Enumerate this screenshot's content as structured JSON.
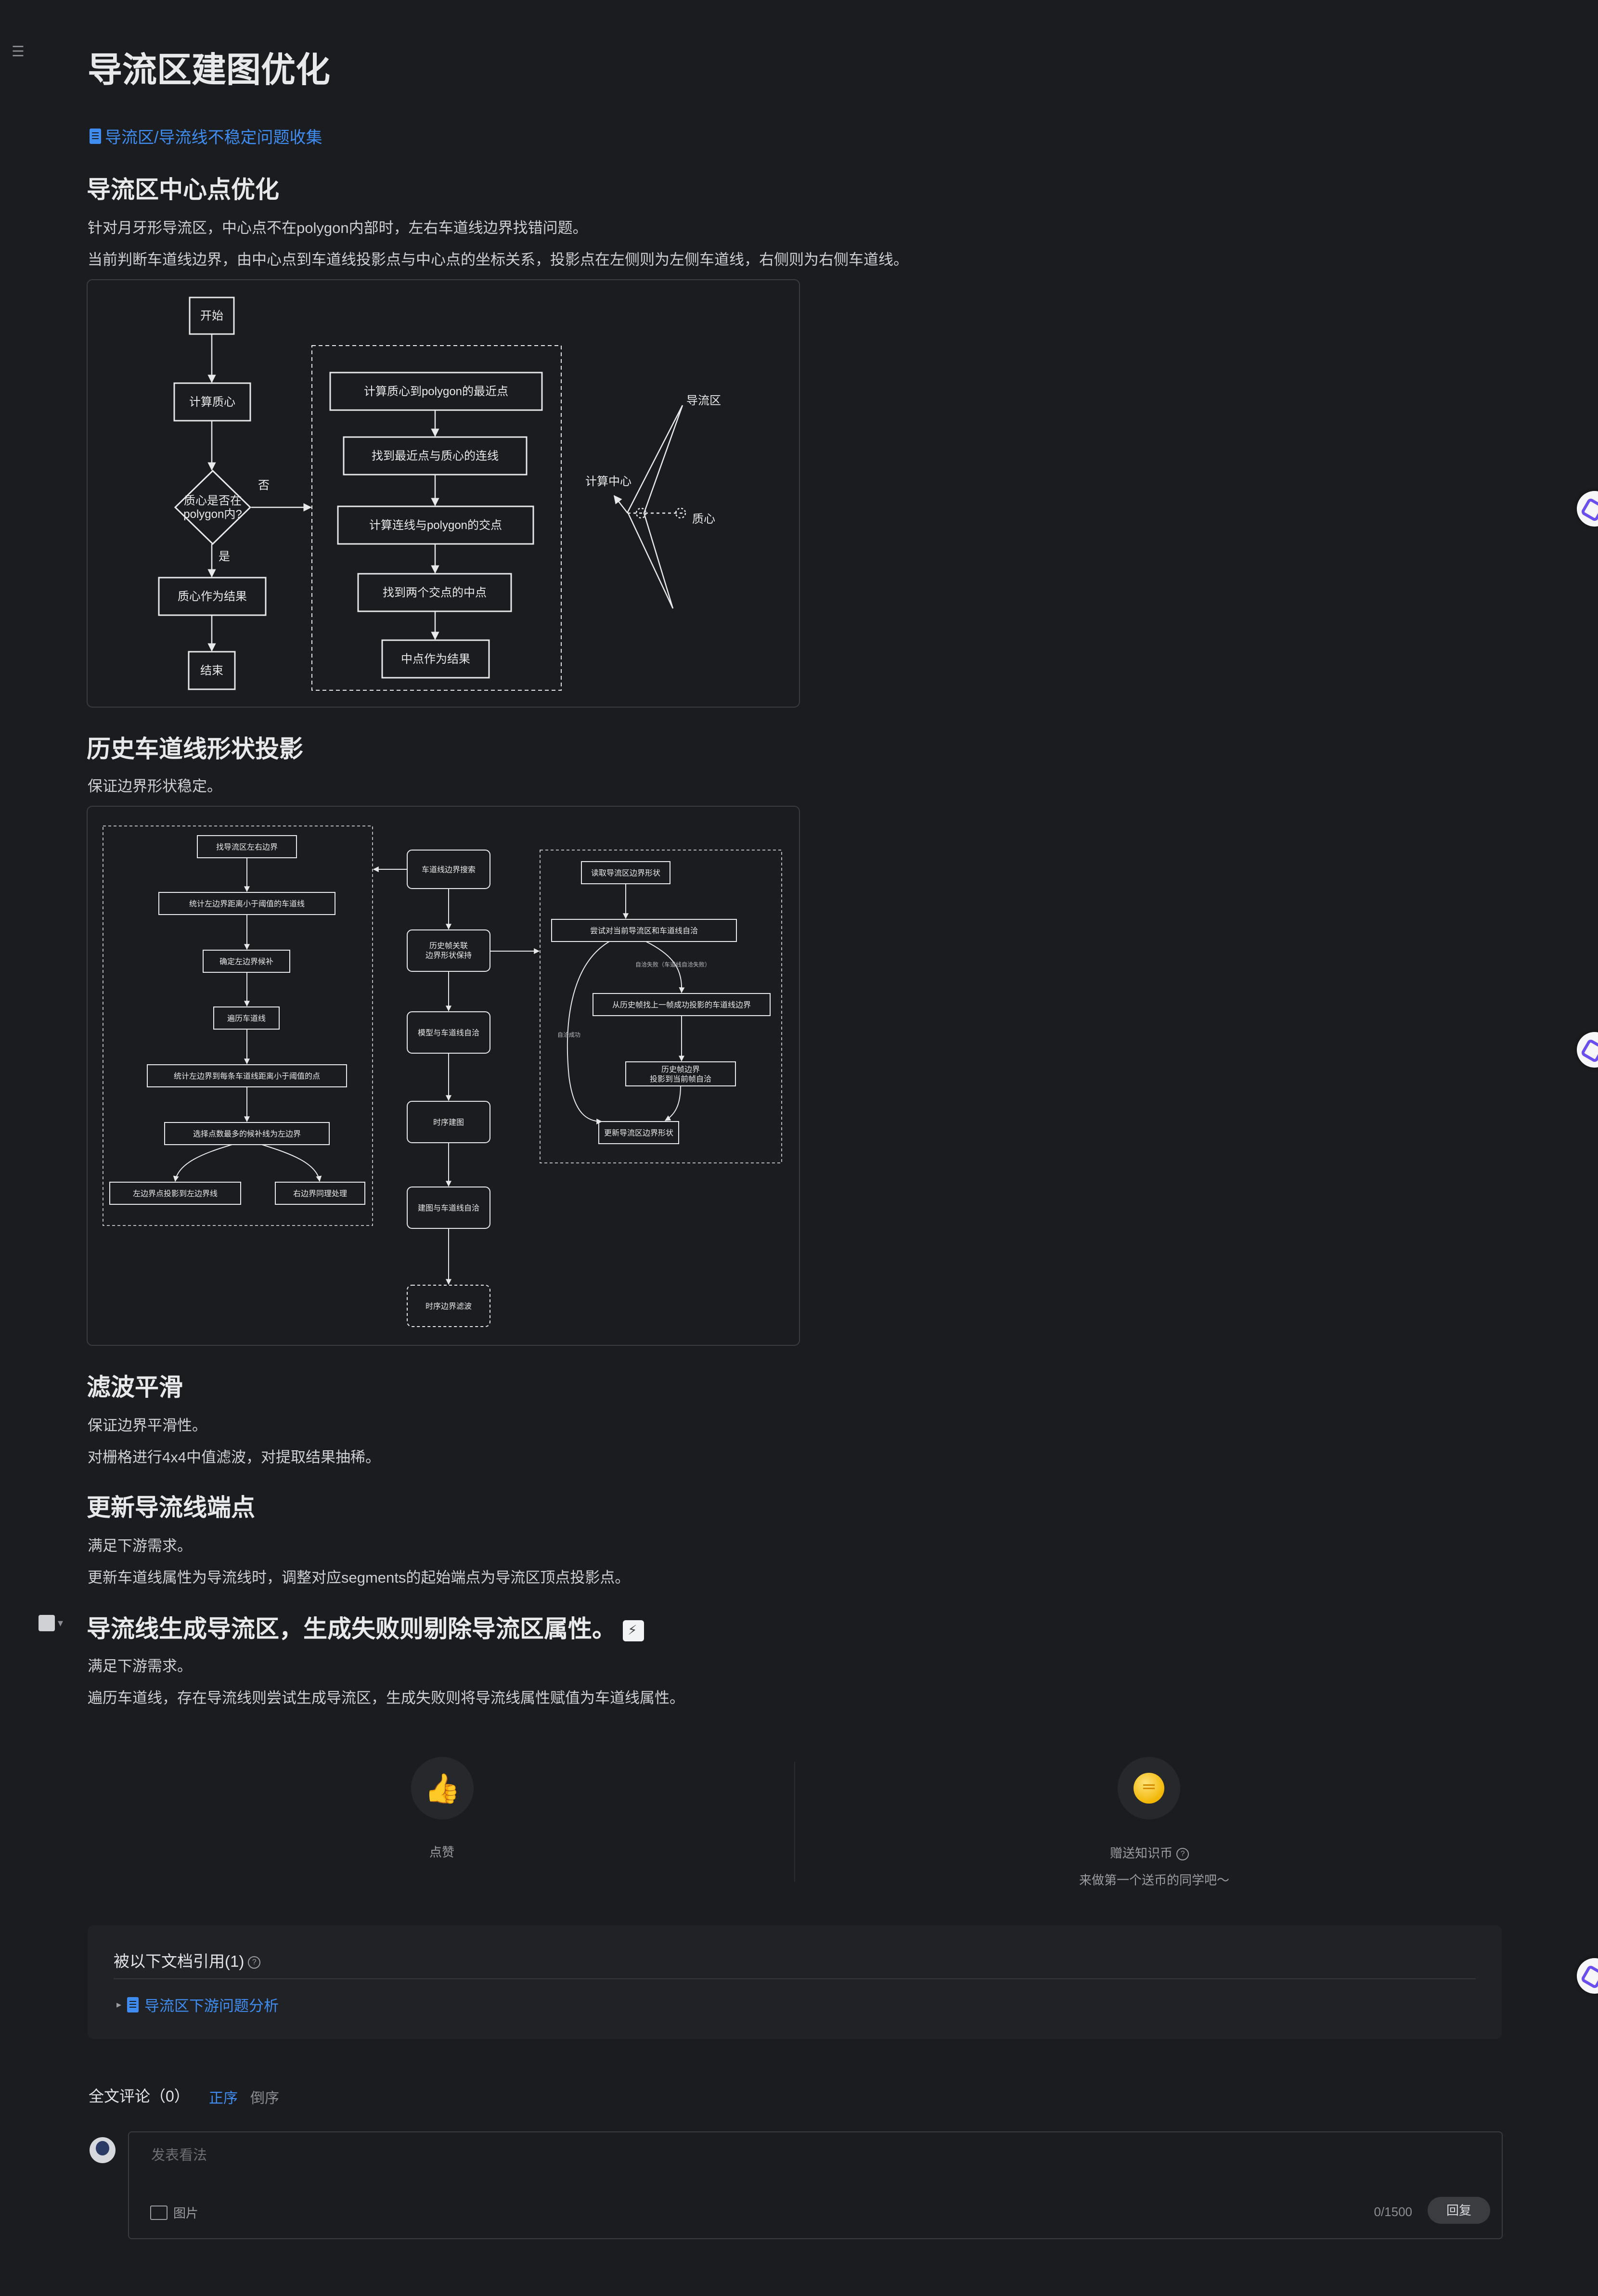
{
  "page": {
    "title": "导流区建图优化",
    "menu_icon": "☰",
    "link": "导流区/导流线不稳定问题收集"
  },
  "sections": {
    "s1": {
      "heading": "导流区中心点优化",
      "p1": "针对月牙形导流区，中心点不在polygon内部时，左右车道线边界找错问题。",
      "p2": "当前判断车道线边界，由中心点到车道线投影点与中心点的坐标关系，投影点在左侧则为左侧车道线，右侧则为右侧车道线。"
    },
    "s2": {
      "heading": "历史车道线形状投影",
      "p1": "保证边界形状稳定。"
    },
    "s3": {
      "heading": "滤波平滑",
      "p1": "保证边界平滑性。",
      "p2": "对栅格进行4x4中值滤波，对提取结果抽稀。"
    },
    "s4": {
      "heading": "更新导流线端点",
      "p1": "满足下游需求。",
      "p2": "更新车道线属性为导流线时，调整对应segments的起始端点为导流区顶点投影点。"
    },
    "s5": {
      "heading": "导流线生成导流区，生成失败则剔除导流区属性。",
      "p1": "满足下游需求。",
      "p2": "遍历车道线，存在导流线则尝试生成导流区，生成失败则将导流线属性赋值为车道线属性。"
    }
  },
  "fig1": {
    "start": "开始",
    "calc_centroid": "计算质心",
    "decision_l1": "质心是否在",
    "decision_l2": "polygon内?",
    "no": "否",
    "yes": "是",
    "centroid_result": "质心作为结果",
    "end": "结束",
    "r1": "计算质心到polygon的最近点",
    "r2": "找到最近点与质心的连线",
    "r3": "计算连线与polygon的交点",
    "r4": "找到两个交点的中点",
    "r5": "中点作为结果",
    "lbl_area": "导流区",
    "lbl_center": "计算中心",
    "lbl_centroid": "质心"
  },
  "fig2": {
    "left": [
      "找导流区左右边界",
      "统计左边界距离小于阈值的车道线",
      "确定左边界候补",
      "遍历车道线",
      "统计左边界到每条车道线距离小于阈值的点",
      "选择点数最多的候补线为左边界",
      "左边界点投影到左边界线",
      "右边界同理处理"
    ],
    "mid": [
      "车道线边界搜索",
      "历史帧关联",
      "边界形状保持",
      "模型与车道线自洽",
      "时序建图",
      "建图与车道线自洽",
      "时序边界滤波"
    ],
    "right": [
      "读取导流区边界形状",
      "尝试对当前导流区和车道线自洽",
      "从历史帧找上一帧成功投影的车道线边界",
      "历史帧边界",
      "投影到当前帧自洽",
      "更新导流区边界形状",
      "自洽失败（车道线自洽失败）",
      "自洽成功"
    ]
  },
  "reactions": {
    "like_label": "点赞",
    "like_icon": "thumbs-up",
    "coin_label": "赠送知识币",
    "coin_hint": "来做第一个送币的同学吧～"
  },
  "references": {
    "title": "被以下文档引用(1)",
    "item": "导流区下游问题分析"
  },
  "comments": {
    "heading": "全文评论（0）",
    "sort_asc": "正序",
    "sort_desc": "倒序",
    "placeholder": "发表看法",
    "image_btn": "图片",
    "count": "0/1500",
    "reply_btn": "回复"
  },
  "colors": {
    "accent": "#3f8df0",
    "bg": "#1b1c1f",
    "like": "#1d6ad6",
    "coin": "#f2b705"
  }
}
